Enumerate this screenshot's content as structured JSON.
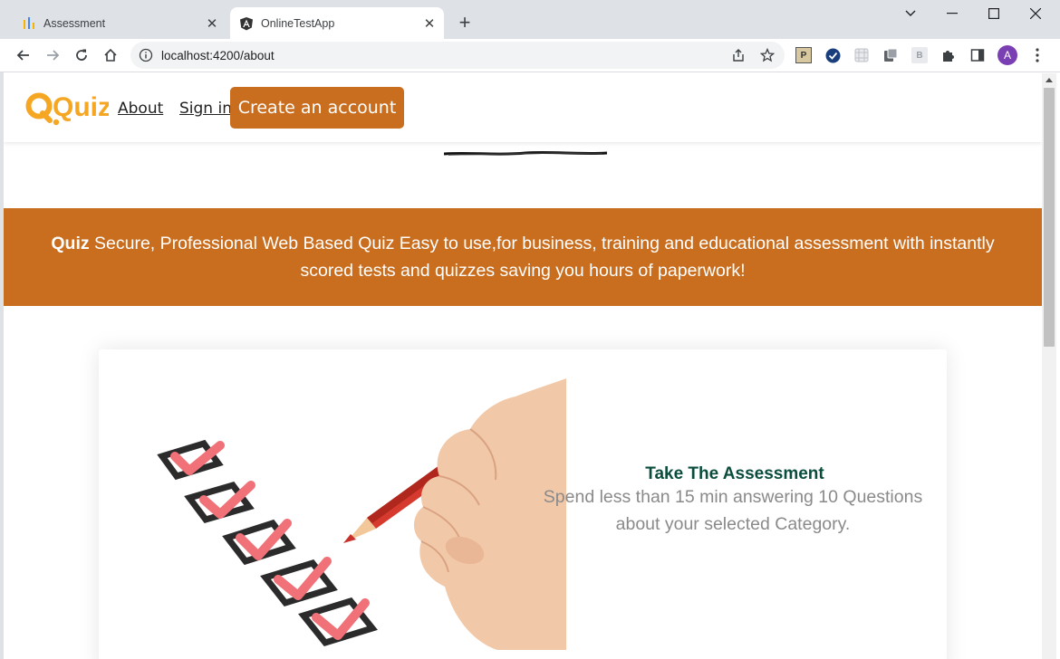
{
  "browser": {
    "tabs": [
      {
        "title": "Assessment",
        "active": false
      },
      {
        "title": "OnlineTestApp",
        "active": true
      }
    ],
    "url": "localhost:4200/about",
    "profile_initial": "A",
    "extension_label_p": "P",
    "extension_label_b": "B"
  },
  "navbar": {
    "logo_text": "Quiz",
    "about_label": "About",
    "signin_label": "Sign in",
    "cta_label": "Create an account"
  },
  "banner": {
    "brand": "Quiz",
    "text": " Secure, Professional Web Based Quiz Easy to use,for business, training and educational assessment with instantly scored tests and quizzes saving you hours of paperwork!"
  },
  "card": {
    "title": "Take The Assessment",
    "text": "Spend less than 15 min answering 10 Questions about your selected Category."
  },
  "colors": {
    "accent": "#c96d1f",
    "title_green": "#0b4d3c",
    "logo_yellow": "#f5a623"
  }
}
